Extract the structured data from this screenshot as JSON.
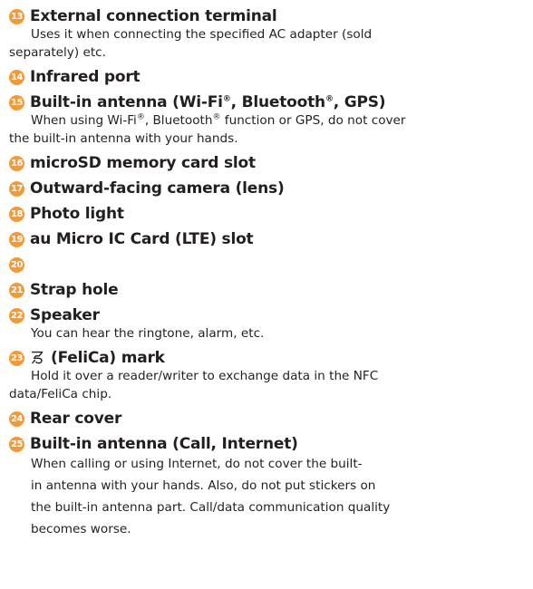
{
  "items": [
    {
      "num": "13",
      "title": "External connection terminal",
      "desc": [
        "Uses it when connecting the specified AC adapter (sold",
        "separately) etc."
      ]
    },
    {
      "num": "14",
      "title": "Infrared port"
    },
    {
      "num": "15",
      "title_parts": [
        "Built-in antenna (Wi-Fi",
        "®",
        ", Bluetooth",
        "®",
        ", GPS)"
      ],
      "desc_parts": [
        "When using Wi-Fi",
        "®",
        ", Bluetooth",
        "®",
        " function or GPS, do not cover"
      ],
      "desc_line2": "the built-in antenna with your hands."
    },
    {
      "num": "16",
      "title": "microSD memory card slot"
    },
    {
      "num": "17",
      "title": "Outward-facing camera (lens)"
    },
    {
      "num": "18",
      "title": "Photo light"
    },
    {
      "num": "19",
      "title": "au Micro IC Card (LTE) slot"
    },
    {
      "num": "20",
      "title": ""
    },
    {
      "num": "21",
      "title": "Strap hole"
    },
    {
      "num": "22",
      "title": "Speaker",
      "desc": [
        "You can hear the ringtone, alarm, etc."
      ]
    },
    {
      "num": "23",
      "icon": "felica-mark-icon",
      "title": "(FeliCa) mark",
      "desc": [
        "Hold it over a reader/writer to exchange data in the NFC",
        "data/FeliCa chip."
      ]
    },
    {
      "num": "24",
      "title": "Rear cover"
    },
    {
      "num": "25",
      "title": "Built-in antenna (Call, Internet)",
      "desc": [
        "When calling or using Internet, do not cover the built-",
        "in antenna with your hands. Also, do not put stickers on",
        "the built-in antenna part. Call/data communication quality",
        "becomes worse."
      ]
    }
  ],
  "colors": {
    "badge": "#f29a3a",
    "text": "#231f20"
  }
}
